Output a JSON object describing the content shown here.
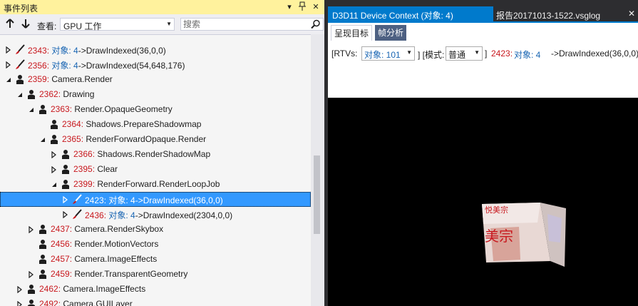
{
  "left_panel": {
    "title": "事件列表",
    "title_buttons": [
      "▾",
      "ᛁ",
      "✕"
    ],
    "toolbar": {
      "view_label": "查看:",
      "view_value": "GPU 工作",
      "search_placeholder": "搜索"
    },
    "tree_rows": [
      {
        "indent": 0,
        "expander": "collapsed",
        "icon": "brush-icon",
        "num": "2343:",
        "prefix": " 对象: 4",
        "text": "->DrawIndexed(36,0,0)"
      },
      {
        "indent": 0,
        "expander": "collapsed",
        "icon": "brush-icon",
        "num": "2356:",
        "prefix": " 对象: 4",
        "text": "->DrawIndexed(54,648,176)"
      },
      {
        "indent": 0,
        "expander": "expanded",
        "icon": "marker-icon",
        "num": "2359:",
        "prefix": "",
        "text": " Camera.Render"
      },
      {
        "indent": 1,
        "expander": "expanded",
        "icon": "marker-icon",
        "num": "2362:",
        "prefix": "",
        "text": " Drawing"
      },
      {
        "indent": 2,
        "expander": "expanded",
        "icon": "marker-icon",
        "num": "2363:",
        "prefix": "",
        "text": " Render.OpaqueGeometry"
      },
      {
        "indent": 3,
        "expander": "none",
        "icon": "marker-icon",
        "num": "2364:",
        "prefix": "",
        "text": " Shadows.PrepareShadowmap"
      },
      {
        "indent": 3,
        "expander": "expanded",
        "icon": "marker-icon",
        "num": "2365:",
        "prefix": "",
        "text": " RenderForwardOpaque.Render"
      },
      {
        "indent": 4,
        "expander": "collapsed",
        "icon": "marker-icon",
        "num": "2366:",
        "prefix": "",
        "text": " Shadows.RenderShadowMap"
      },
      {
        "indent": 4,
        "expander": "collapsed",
        "icon": "marker-icon",
        "num": "2395:",
        "prefix": "",
        "text": " Clear"
      },
      {
        "indent": 4,
        "expander": "expanded",
        "icon": "marker-icon",
        "num": "2399:",
        "prefix": "",
        "text": " RenderForward.RenderLoopJob"
      },
      {
        "indent": 5,
        "expander": "collapsed",
        "icon": "brush-icon",
        "num": "2423:",
        "prefix": " 对象: 4",
        "text": "->DrawIndexed(36,0,0)",
        "selected": true
      },
      {
        "indent": 5,
        "expander": "collapsed",
        "icon": "brush-icon",
        "num": "2436:",
        "prefix": " 对象: 4",
        "text": "->DrawIndexed(2304,0,0)"
      },
      {
        "indent": 2,
        "expander": "collapsed",
        "icon": "marker-icon",
        "num": "2437:",
        "prefix": "",
        "text": " Camera.RenderSkybox"
      },
      {
        "indent": 2,
        "expander": "none",
        "icon": "marker-icon",
        "num": "2456:",
        "prefix": "",
        "text": " Render.MotionVectors"
      },
      {
        "indent": 2,
        "expander": "none",
        "icon": "marker-icon",
        "num": "2457:",
        "prefix": "",
        "text": " Camera.ImageEffects"
      },
      {
        "indent": 2,
        "expander": "collapsed",
        "icon": "marker-icon",
        "num": "2459:",
        "prefix": "",
        "text": " Render.TransparentGeometry"
      },
      {
        "indent": 1,
        "expander": "collapsed",
        "icon": "marker-icon",
        "num": "2462:",
        "prefix": "",
        "text": " Camera.ImageEffects"
      },
      {
        "indent": 1,
        "expander": "collapsed",
        "icon": "marker-icon",
        "num": "2492:",
        "prefix": "",
        "text": " Camera.GUILayer"
      }
    ]
  },
  "right_panel": {
    "doc_tabs": [
      {
        "label": "D3D11 Device Context (对象: 4)",
        "active": true
      },
      {
        "label": "报告20171013-1522.vsglog",
        "active": false,
        "close": "✕"
      }
    ],
    "subtabs": [
      "呈现目标",
      "帧分析"
    ],
    "rtv_bar": {
      "rtvs_label": "[RTVs:",
      "rtv_value": "对象: 101",
      "mode_label": "] [模式:",
      "mode_value": "普通",
      "tail_close": "]",
      "event_num": "2423:",
      "event_obj": "对象: 4",
      "event_text": "->DrawIndexed(36,0,0)"
    },
    "cube_texture_text": "美宗"
  },
  "colors": {
    "accent": "#007acc",
    "selection": "#3399ff",
    "event_number": "#c8181e",
    "object_ref": "#1a66b3",
    "title_highlight": "#fff29d"
  }
}
